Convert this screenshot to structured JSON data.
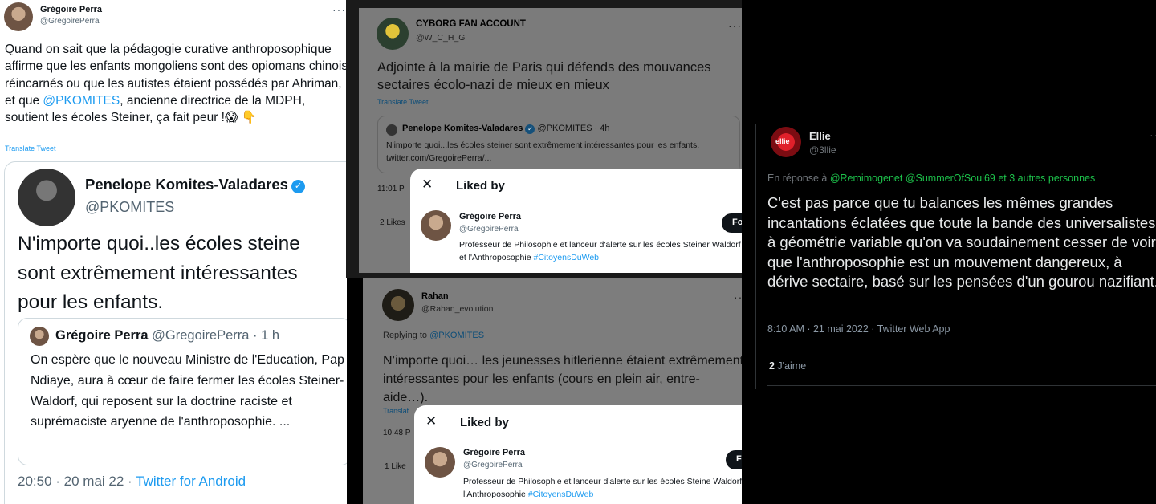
{
  "tweet1": {
    "name": "Grégoire Perra",
    "handle": "@GregoirePerra",
    "more": "···",
    "text_a": "Quand on sait que la pédagogie curative anthroposophique affirme que les enfants mongoliens sont des opiomans chinois réincarnés ou que les autistes étaient possédés par Ahriman, et que ",
    "mention": "@PKOMITES",
    "text_b": ", ancienne directrice de la MDPH, soutient les écoles Steiner, ça fait peur !",
    "emoji": "😱 👇",
    "translate": "Translate Tweet",
    "quoted": {
      "name": "Penelope Komites-Valadares",
      "verified": "✓",
      "handle": "@PKOMITES",
      "line1": "N'importe quoi..les écoles steine",
      "line2": "sont extrêmement intéressantes",
      "line3": "pour les enfants.",
      "inner": {
        "name": "Grégoire Perra",
        "handle_time": " @GregoirePerra · 1 h",
        "text": "On espère que le nouveau Ministre de l'Education, Pap Ndiaye, aura à cœur de faire fermer les écoles Steiner-Waldorf, qui reposent sur la doctrine raciste et suprémaciste aryenne de l'anthroposophie. ..."
      },
      "timestamp": "20:50 · 20 mai 22 · ",
      "source": "Twitter for Android"
    }
  },
  "tweet2": {
    "name": "CYBORG FAN ACCOUNT",
    "handle": "@W_C_H_G",
    "more": "···",
    "text": "Adjointe à la mairie de Paris qui défends des mouvances sectaires écolo-nazi de mieux en mieux",
    "translate": "Translate Tweet",
    "quoted": {
      "name": "Penelope Komites-Valadares",
      "verified": "✓",
      "handle_time": " @PKOMITES · 4h",
      "text": "N'importe quoi...les écoles steiner sont extrêmement intéressantes pour les enfants. twitter.com/GregoirePerra/..."
    },
    "time": "11:01 P",
    "likes": "2 Likes"
  },
  "liked_modal_1": {
    "close": "✕",
    "title": "Liked by",
    "name": "Grégoire Perra",
    "handle": "@GregoirePerra",
    "bio": "Professeur de Philosophie et lanceur d'alerte sur les écoles Steiner Waldorf et l'Anthroposophie ",
    "hashtag": "#CitoyensDuWeb",
    "follow": "Fo"
  },
  "tweet3": {
    "name": "Rahan",
    "handle": "@Rahan_evolution",
    "more": "···",
    "replying": "Replying to ",
    "replying_to": "@PKOMITES",
    "text": "N’importe quoi… les jeunesses hitlerienne étaient extrêmement intéressantes pour les enfants (cours en plein air, entre-aide…).",
    "translate": "Translat",
    "time": "10:48 P",
    "likes": "1 Like"
  },
  "liked_modal_2": {
    "close": "✕",
    "title": "Liked by",
    "name": "Grégoire Perra",
    "handle": "@GregoirePerra",
    "bio": "Professeur de Philosophie et lanceur d'alerte sur les écoles Steine Waldorf et l'Anthroposophie ",
    "hashtag": "#CitoyensDuWeb",
    "follow": "F"
  },
  "tweet4": {
    "name": "Ellie",
    "handle": "@3llie",
    "more": "···",
    "avatar_text": "ellie",
    "reply_prefix": "En réponse à ",
    "reply_to": "@Remimogenet @SummerOfSoul69  et 3 autres personnes",
    "text": "C'est pas parce que tu balances les mêmes grandes incantations éclatées que toute la bande des universalistes à géométrie variable qu'on va soudainement cesser de voir que l'anthroposophie est un mouvement dangereux, à dérive sectaire, basé sur les pensées d'un gourou nazifiant.",
    "time": "8:10 AM · 21 mai 2022 · Twitter Web App",
    "likes_count": "2",
    "likes_label": " J'aime"
  },
  "colors": {
    "link_blue": "#1d9bf0",
    "dark_bg": "#000000",
    "reply_green": "#1dc24b"
  }
}
